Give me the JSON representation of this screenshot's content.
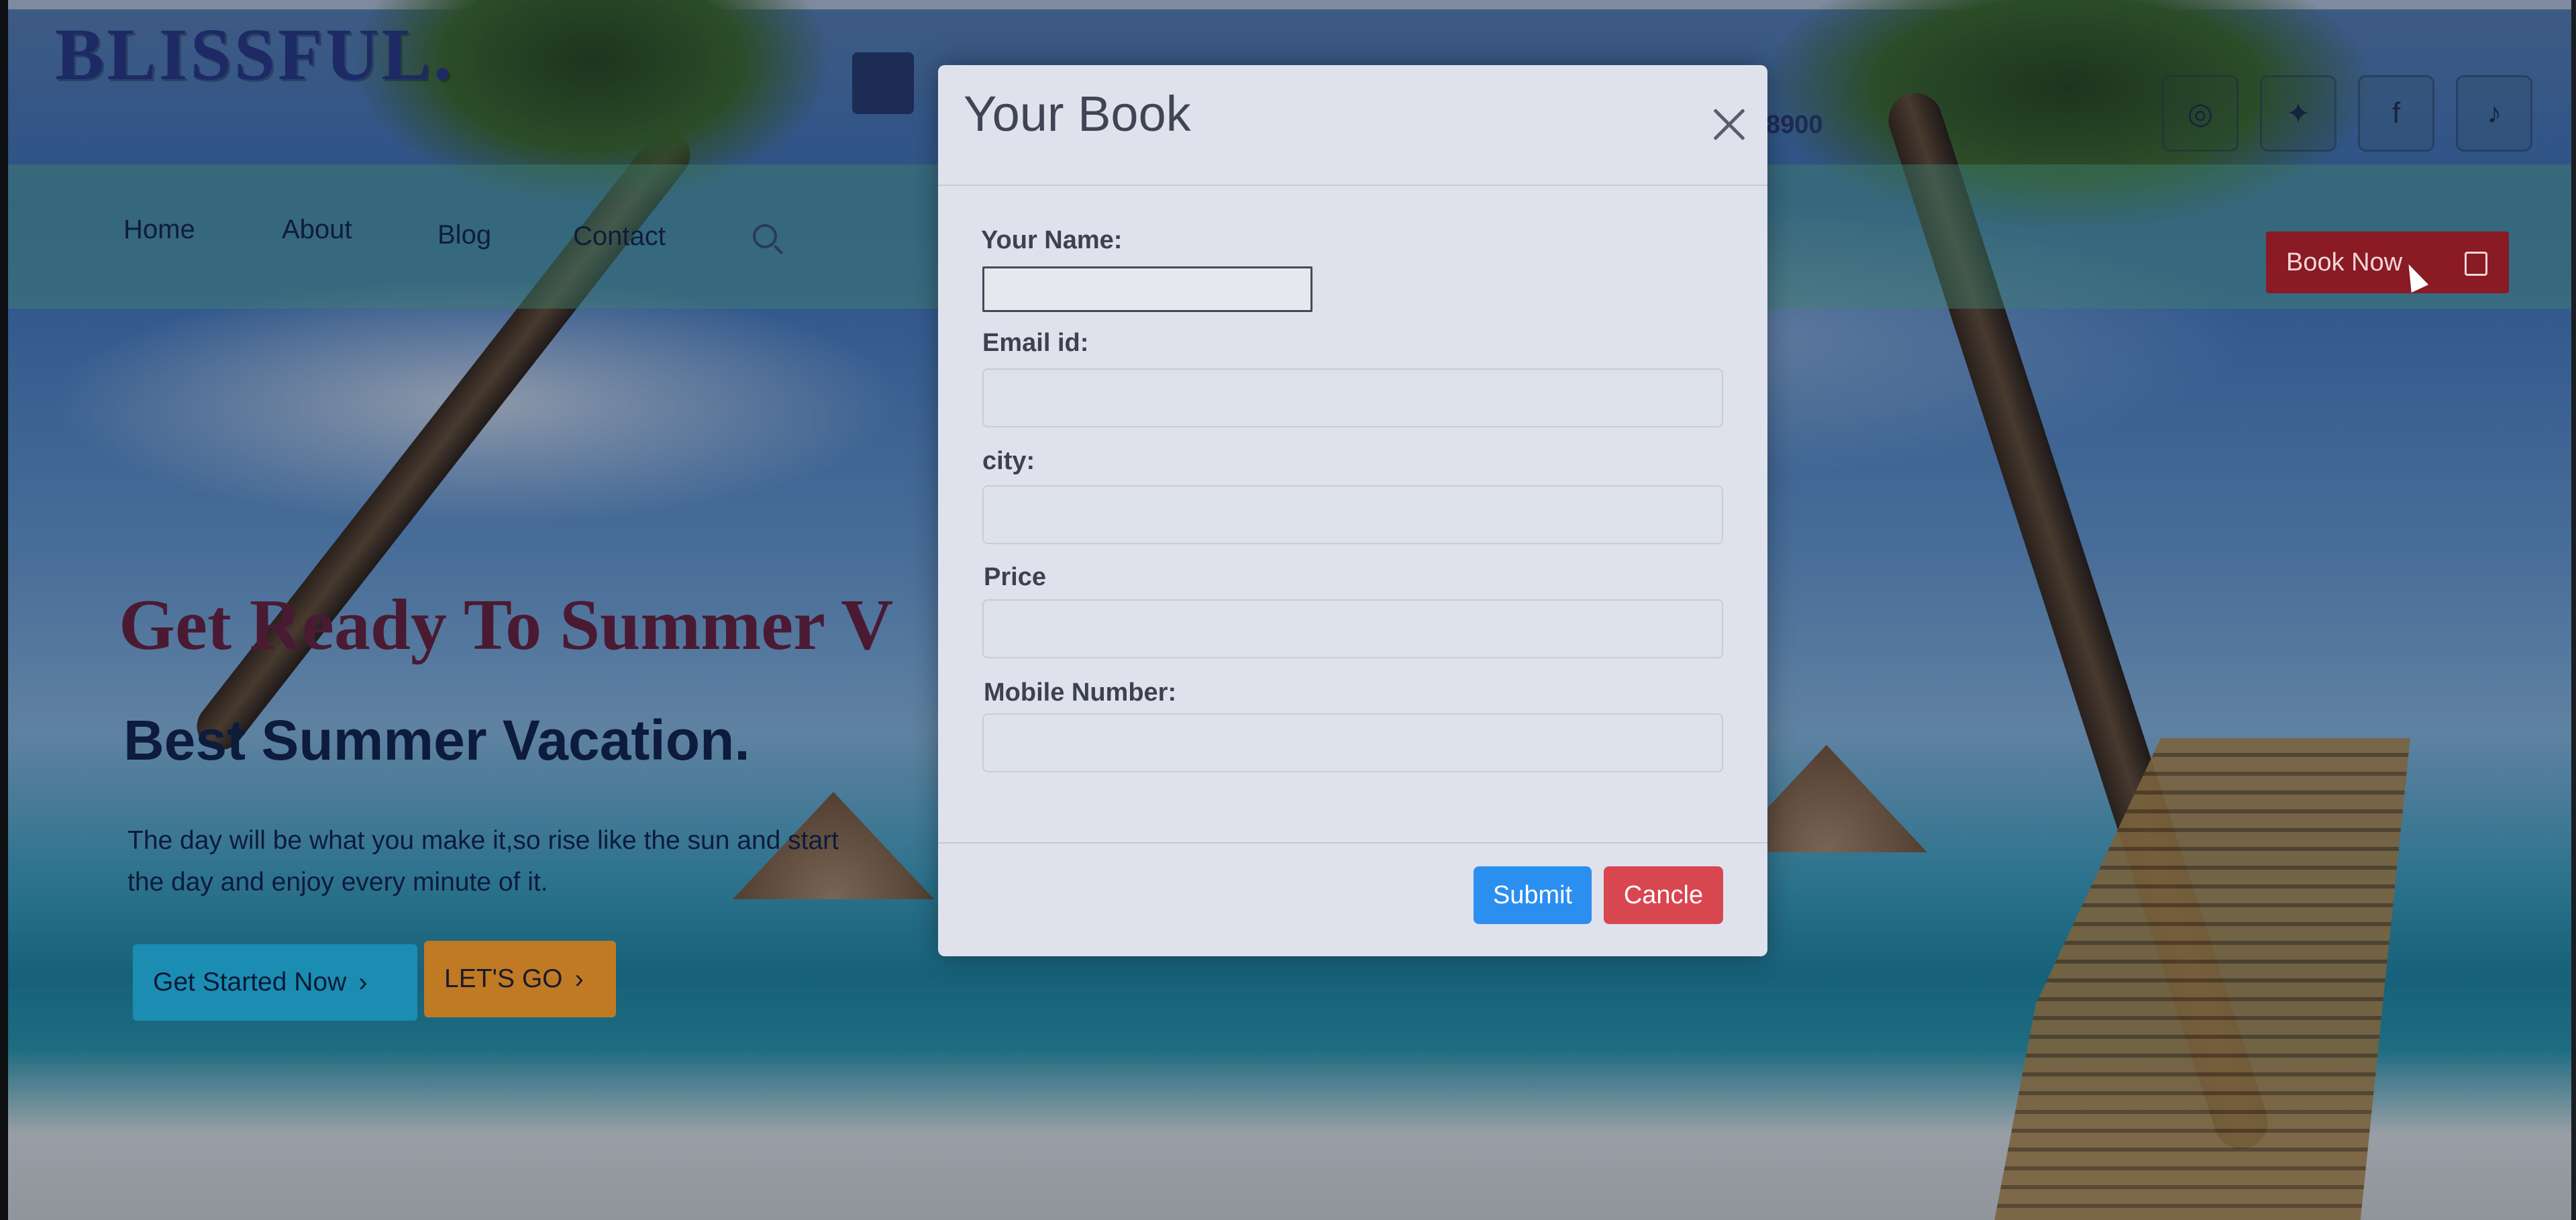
{
  "header": {
    "brand": "BLISSFUL.",
    "phone": "8900",
    "book_now": "Book Now",
    "nav": [
      "Home",
      "About",
      "Blog",
      "Contact"
    ],
    "social_icons": [
      "instagram-icon",
      "twitter-icon",
      "facebook-icon",
      "bell-icon"
    ]
  },
  "hero": {
    "title": "Get Ready To Summer V",
    "subtitle": "Best Summer Vacation.",
    "text": "The day will be what you make it,so rise like the sun and start the day and enjoy every minute of it.",
    "primary_button": "Get Started Now",
    "secondary_button": "LET'S GO"
  },
  "modal": {
    "title": "Your Book",
    "fields": [
      {
        "label": "Your Name:",
        "value": ""
      },
      {
        "label": "Email id:",
        "value": ""
      },
      {
        "label": "city:",
        "value": ""
      },
      {
        "label": "Price",
        "value": ""
      },
      {
        "label": "Mobile Number:",
        "value": ""
      }
    ],
    "submit": "Submit",
    "cancel": "Cancle"
  },
  "colors": {
    "brand": "#1d2a66",
    "book_now_bg": "#8a1a24",
    "submit_bg": "#2b8ff0",
    "cancel_bg": "#d84650",
    "start_bg": "#1b8db3",
    "letsgo_bg": "#c07a23"
  }
}
